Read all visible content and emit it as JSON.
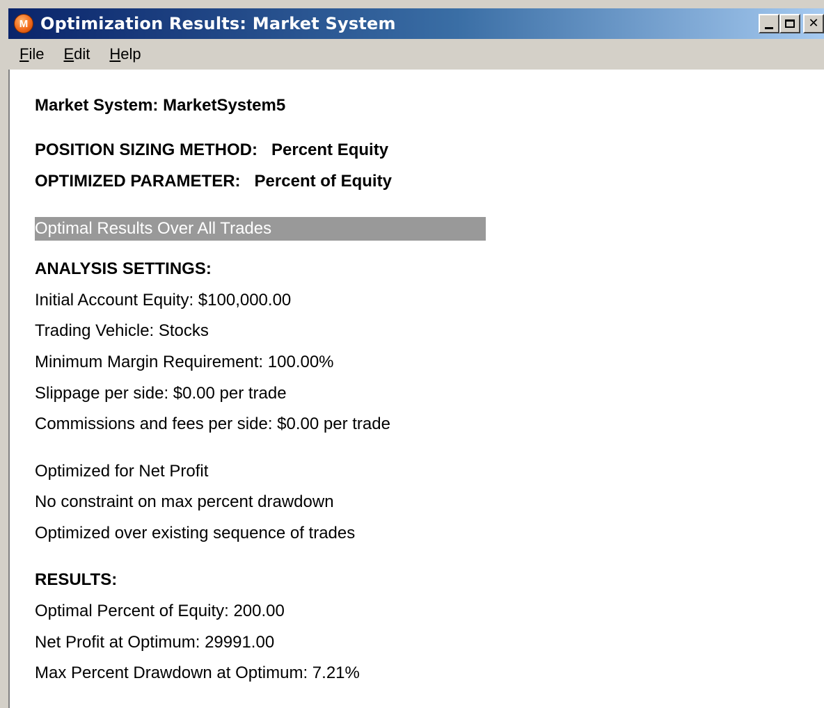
{
  "window": {
    "title": "Optimization Results: Market System",
    "icon_letter": "M",
    "icon": "app-logo-icon"
  },
  "menu": {
    "file": {
      "first": "F",
      "rest": "ile"
    },
    "edit": {
      "first": "E",
      "rest": "dit"
    },
    "help": {
      "first": "H",
      "rest": "elp"
    }
  },
  "report": {
    "market_system": "Market System: MarketSystem5",
    "position_sizing": "POSITION SIZING METHOD:   Percent Equity",
    "optimized_parameter": "OPTIMIZED PARAMETER:   Percent of Equity",
    "section_banner": "Optimal Results Over All Trades",
    "analysis_heading": "ANALYSIS SETTINGS:",
    "initial_equity": "Initial Account Equity: $100,000.00",
    "trading_vehicle": "Trading Vehicle: Stocks",
    "min_margin": "Minimum Margin Requirement: 100.00%",
    "slippage": "Slippage per side: $0.00 per trade",
    "commissions": "Commissions and fees per side: $0.00 per trade",
    "optimized_for": "Optimized for Net Profit",
    "constraint": "No constraint on max percent drawdown",
    "optimized_over": "Optimized over existing sequence of trades",
    "results_heading": "RESULTS:",
    "optimal_percent": "Optimal Percent of Equity: 200.00",
    "net_profit": "Net Profit at Optimum: 29991.00",
    "max_drawdown": "Max Percent Drawdown at Optimum: 7.21%"
  },
  "colors": {
    "title_gradient_start": "#0a246a",
    "title_gradient_end": "#a6caf0",
    "banner_bg": "#999999",
    "banner_text": "#ffffff"
  }
}
